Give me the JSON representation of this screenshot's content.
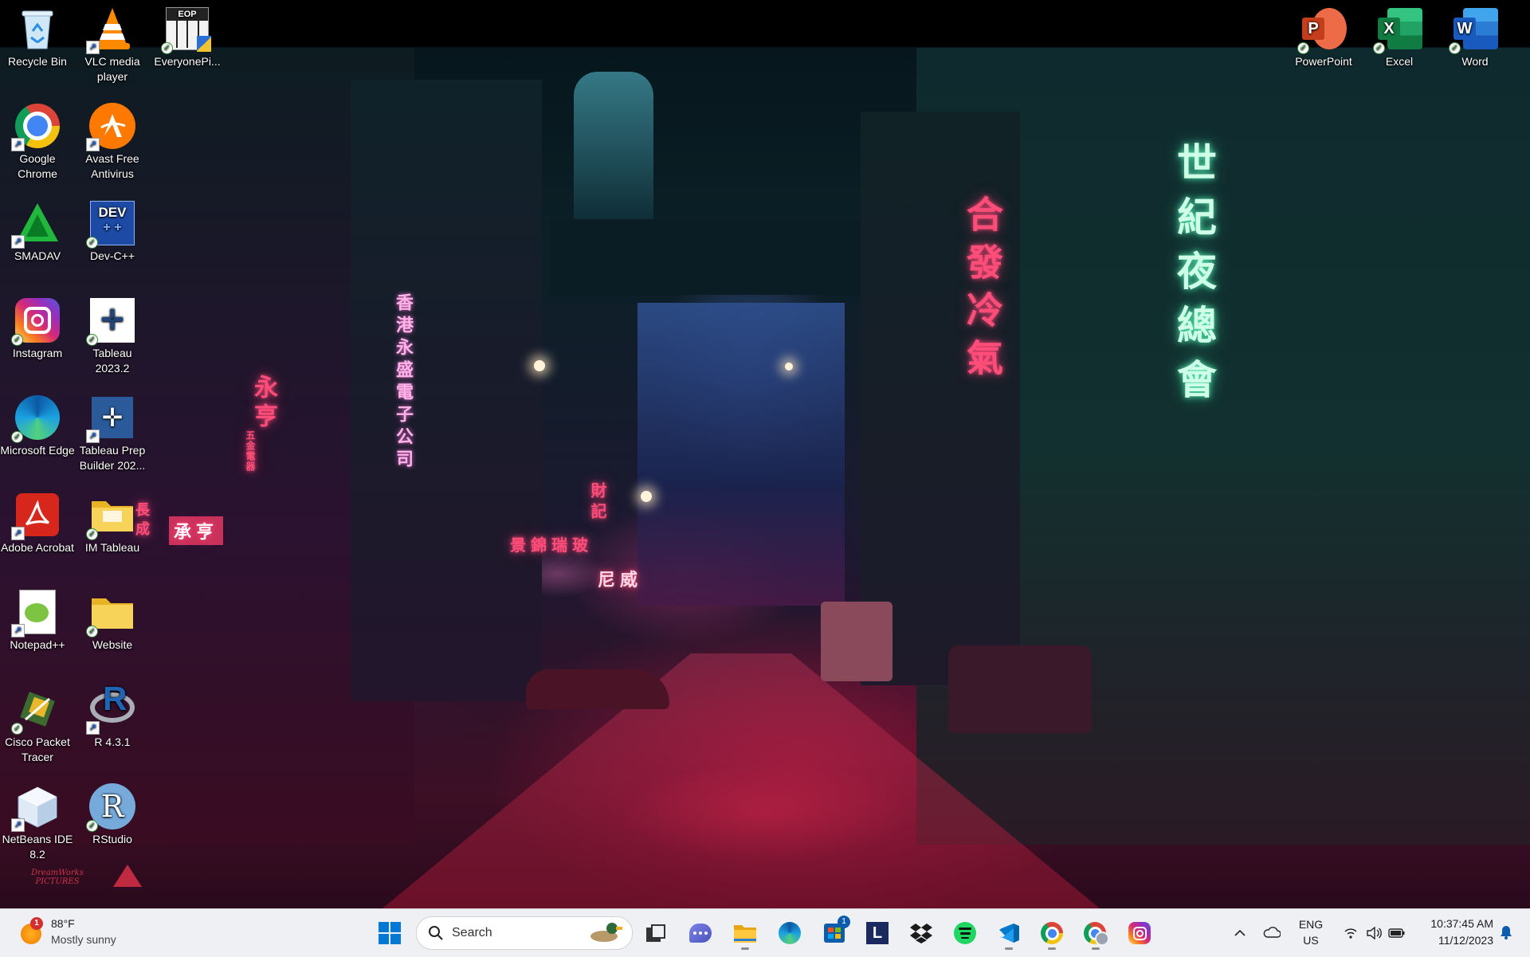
{
  "desktop": {
    "icons": [
      {
        "label": "Recycle Bin",
        "icon": "recycle-bin-icon"
      },
      {
        "label": "VLC media player",
        "icon": "vlc-icon"
      },
      {
        "label": "EveryonePi...",
        "icon": "everyonepiano-icon"
      },
      {
        "label": "Google Chrome",
        "icon": "chrome-icon"
      },
      {
        "label": "Avast Free Antivirus",
        "icon": "avast-icon"
      },
      {
        "label": "SMADAV",
        "icon": "smadav-icon"
      },
      {
        "label": "Dev-C++",
        "icon": "devcpp-icon"
      },
      {
        "label": "Instagram",
        "icon": "instagram-icon"
      },
      {
        "label": "Tableau 2023.2",
        "icon": "tableau-icon"
      },
      {
        "label": "Microsoft Edge",
        "icon": "edge-icon"
      },
      {
        "label": "Tableau Prep Builder 202...",
        "icon": "tableau-prep-icon"
      },
      {
        "label": "Adobe Acrobat",
        "icon": "acrobat-icon"
      },
      {
        "label": "IM Tableau",
        "icon": "folder-icon"
      },
      {
        "label": "Notepad++",
        "icon": "notepadpp-icon"
      },
      {
        "label": "Website",
        "icon": "folder-icon"
      },
      {
        "label": "Cisco Packet Tracer",
        "icon": "cisco-packet-tracer-icon"
      },
      {
        "label": "R 4.3.1",
        "icon": "r-icon"
      },
      {
        "label": "NetBeans IDE 8.2",
        "icon": "netbeans-icon"
      },
      {
        "label": "RStudio",
        "icon": "rstudio-icon"
      },
      {
        "label": "PowerPoint",
        "icon": "powerpoint-icon"
      },
      {
        "label": "Excel",
        "icon": "excel-icon"
      },
      {
        "label": "Word",
        "icon": "word-icon"
      }
    ],
    "icon_glyphs": {
      "everyonepiano_badge": "EOP",
      "devcpp_badge": "DEV",
      "r_glyph": "R",
      "powerpoint_glyph": "P",
      "excel_glyph": "X",
      "word_glyph": "W"
    },
    "wallpaper_signs": {
      "left_red": "永亨",
      "left_red_small": "五金電器",
      "pink_vertical": "香港永盛電子公司",
      "center_red": "財記",
      "center_row": "景錦瑞玻",
      "center_sign": "尼威",
      "tall_red": "合發冷氣",
      "green_vertical": "世紀夜總會",
      "left_board": "承亨",
      "left_board2": "長成",
      "bottom_left_logo": "DreamWorks PICTURES"
    }
  },
  "taskbar": {
    "weather": {
      "temp": "88°F",
      "condition": "Mostly sunny",
      "badge": "1"
    },
    "search": {
      "placeholder": "Search"
    },
    "store_badge": "1",
    "apps": [
      "start-button",
      "search-box",
      "task-view",
      "chat",
      "file-explorer",
      "edge",
      "microsoft-store",
      "lastpass",
      "dropbox",
      "spotify",
      "vscode",
      "chrome",
      "chrome-profile",
      "instagram"
    ],
    "lastpass_glyph": "L",
    "tray": {
      "language_line1": "ENG",
      "language_line2": "US",
      "time": "10:37:45 AM",
      "date": "11/12/2023"
    }
  },
  "colors": {
    "taskbar_bg": "#eef0f4",
    "windows_blue": "#0078d4",
    "neon_pink": "#ff4d7a",
    "neon_green": "#cfffe6"
  }
}
